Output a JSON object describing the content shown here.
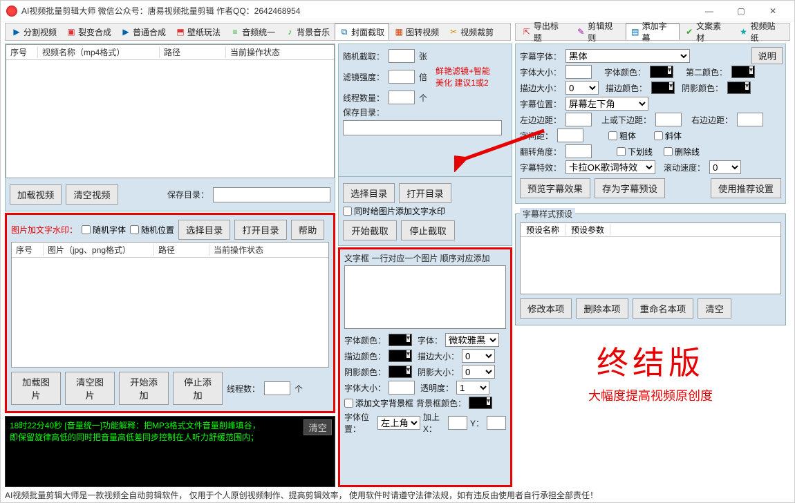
{
  "window": {
    "title": "AI视频批量剪辑大师   微信公众号：唐易视频批量剪辑   作者QQ：2642468954",
    "min": "—",
    "max": "▢",
    "close": "✕"
  },
  "tabs_left": [
    {
      "label": "分割视频",
      "icon": "▶",
      "color": "#06a"
    },
    {
      "label": "裂变合成",
      "icon": "▣",
      "color": "#d33"
    },
    {
      "label": "普通合成",
      "icon": "▶",
      "color": "#06a"
    },
    {
      "label": "壁纸玩法",
      "icon": "⬒",
      "color": "#d33"
    },
    {
      "label": "音频统一",
      "icon": "≡",
      "color": "#3a3"
    },
    {
      "label": "背景音乐",
      "icon": "♪",
      "color": "#3a3"
    },
    {
      "label": "封面截取",
      "icon": "⧉",
      "color": "#06a",
      "active": true
    },
    {
      "label": "图转视频",
      "icon": "▦",
      "color": "#c40"
    },
    {
      "label": "视频裁剪",
      "icon": "✂",
      "color": "#c80"
    }
  ],
  "tabs_right": [
    {
      "label": "导出标题",
      "icon": "⇱",
      "color": "#d33"
    },
    {
      "label": "剪辑规则",
      "icon": "✎",
      "color": "#a0a"
    },
    {
      "label": "添加字幕",
      "icon": "▤",
      "color": "#06a",
      "active": true
    },
    {
      "label": "文案素材",
      "icon": "✔",
      "color": "#3a3"
    },
    {
      "label": "视频贴纸",
      "icon": "★",
      "color": "#0aa"
    }
  ],
  "grid1": {
    "h1": "序号",
    "h2": "视频名称（mp4格式）",
    "h3": "路径",
    "h4": "当前操作状态"
  },
  "left_btns": {
    "load": "加载视频",
    "clear": "清空视频",
    "savedir": "保存目录："
  },
  "wm": {
    "title": "图片加文字水印：",
    "rnd_font": "随机字体",
    "rnd_pos": "随机位置",
    "seldir": "选择目录",
    "opendir": "打开目录",
    "help": "帮助"
  },
  "grid2": {
    "h1": "序号",
    "h2": "图片（jpg、png格式）",
    "h3": "路径",
    "h4": "当前操作状态"
  },
  "wm_btns": {
    "load": "加载图片",
    "clear": "清空图片",
    "start": "开始添加",
    "stop": "停止添加",
    "threads": "线程数：",
    "unit": "个"
  },
  "mid": {
    "rc": "随机截取：",
    "rc_u": "张",
    "fi": "滤镜强度：",
    "fi_u": "倍",
    "fi_hint1": "鲜艳滤镜+智能",
    "fi_hint2": "美化 建议1或2",
    "tc": "线程数量：",
    "tc_u": "个",
    "sd": "保存目录：",
    "seldir": "选择目录",
    "opendir": "打开目录",
    "wmchk": "同时给图片添加文字水印",
    "start": "开始截取",
    "stop": "停止截取",
    "tbhint": "文字框 一行对应一个图片 顺序对应添加",
    "fc": "字体颜色：",
    "ft": "字体：",
    "ft_v": "微软雅黑",
    "sc": "描边颜色：",
    "ss": "描边大小：",
    "ss_v": "0",
    "shc": "阴影颜色：",
    "shs": "阴影大小：",
    "shs_v": "0",
    "fs": "字体大小：",
    "op": "透明度：",
    "op_v": "1",
    "bgchk": "添加文字背景框",
    "bgc": "背景框颜色：",
    "pos": "字体位置：",
    "pos_v": "左上角",
    "addx": "加上X：",
    "y": "Y："
  },
  "right": {
    "explain": "说明",
    "ff": "字幕字体：",
    "ff_v": "黑体",
    "fs": "字体大小：",
    "fc": "字体颜色：",
    "c2": "第二颜色：",
    "ss": "描边大小：",
    "ss_v": "0",
    "sc": "描边颜色：",
    "shc": "阴影颜色：",
    "sp": "字幕位置：",
    "sp_v": "屏幕左下角",
    "ml": "左边边距：",
    "mt": "上或下边距：",
    "mr": "右边边距：",
    "ls": "字间距：",
    "bold": "粗体",
    "italic": "斜体",
    "ra": "翻转角度：",
    "ul": "下划线",
    "so": "删除线",
    "fx": "字幕特效：",
    "fx_v": "卡拉OK歌词特效",
    "spd": "滚动速度：",
    "spd_v": "0",
    "preview": "预览字幕效果",
    "savepreset": "存为字幕预设",
    "userec": "使用推荐设置",
    "pg": "字幕样式预设",
    "ph1": "预设名称",
    "ph2": "预设参数",
    "mod": "修改本项",
    "del": "删除本项",
    "ren": "重命名本项",
    "clr": "清空"
  },
  "log": {
    "l1": "18时22分40秒 [音量统一]功能解释：把MP3格式文件音量削峰填谷，",
    "l2": "      即保留旋律高低的同时把音量高低差同步控制在人听力舒缓范围内；",
    "clear": "清空"
  },
  "promo": {
    "t1": "终结版",
    "t2": "大幅度提高视频原创度"
  },
  "footer": "AI视频批量剪辑大师是一款视频全自动剪辑软件， 仅用于个人原创视频制作、提高剪辑效率， 使用软件时请遵守法律法规，如有违反由使用者自行承担全部责任！"
}
